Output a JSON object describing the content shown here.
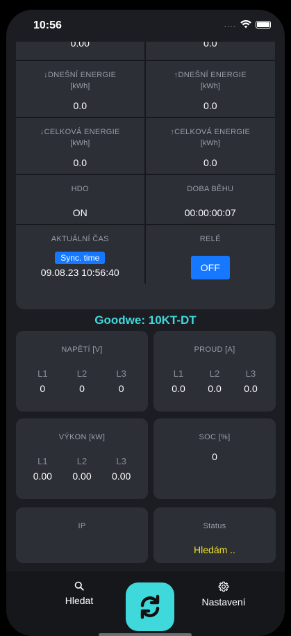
{
  "statusbar": {
    "time": "10:56",
    "dots": "...."
  },
  "top_panel": {
    "partial_row": {
      "left_value": "0.00",
      "right_value": "0.0"
    },
    "rows": [
      {
        "left": {
          "label": "↓DNEŠNÍ ENERGIE",
          "unit": "[kWh]",
          "value": "0.0"
        },
        "right": {
          "label": "↑DNEŠNÍ ENERGIE",
          "unit": "[kWh]",
          "value": "0.0"
        }
      },
      {
        "left": {
          "label": "↓CELKOVÁ ENERGIE",
          "unit": "[kWh]",
          "value": "0.0"
        },
        "right": {
          "label": "↑CELKOVÁ ENERGIE",
          "unit": "[kWh]",
          "value": "0.0"
        }
      },
      {
        "left": {
          "label": "HDO",
          "value": "ON"
        },
        "right": {
          "label": "DOBA BĚHU",
          "value": "00:00:00:07"
        }
      }
    ],
    "time_cell": {
      "label": "AKTUÁLNÍ ČAS",
      "sync_label": "Sync. time",
      "value": "09.08.23 10:56:40"
    },
    "rele_cell": {
      "label": "RELÉ",
      "button": "OFF"
    }
  },
  "device_title": "Goodwe: 10KT-DT",
  "cards": {
    "napeti": {
      "title": "NAPĚTÍ [V]",
      "phases": [
        "L1",
        "L2",
        "L3"
      ],
      "values": [
        "0",
        "0",
        "0"
      ]
    },
    "proud": {
      "title": "PROUD [A]",
      "phases": [
        "L1",
        "L2",
        "L3"
      ],
      "values": [
        "0.0",
        "0.0",
        "0.0"
      ]
    },
    "vykon": {
      "title": "VÝKON [kW]",
      "phases": [
        "L1",
        "L2",
        "L3"
      ],
      "values": [
        "0.00",
        "0.00",
        "0.00"
      ]
    },
    "soc": {
      "title": "SOC [%]",
      "value": "0"
    },
    "ip": {
      "title": "IP"
    },
    "status": {
      "title": "Status",
      "value": "Hledám .."
    }
  },
  "tabbar": {
    "search_label": "Hledat",
    "settings_label": "Nastavení"
  },
  "colors": {
    "accent": "#3fd9dc",
    "button_blue": "#1677ff",
    "status_yellow": "#f1e22a"
  }
}
